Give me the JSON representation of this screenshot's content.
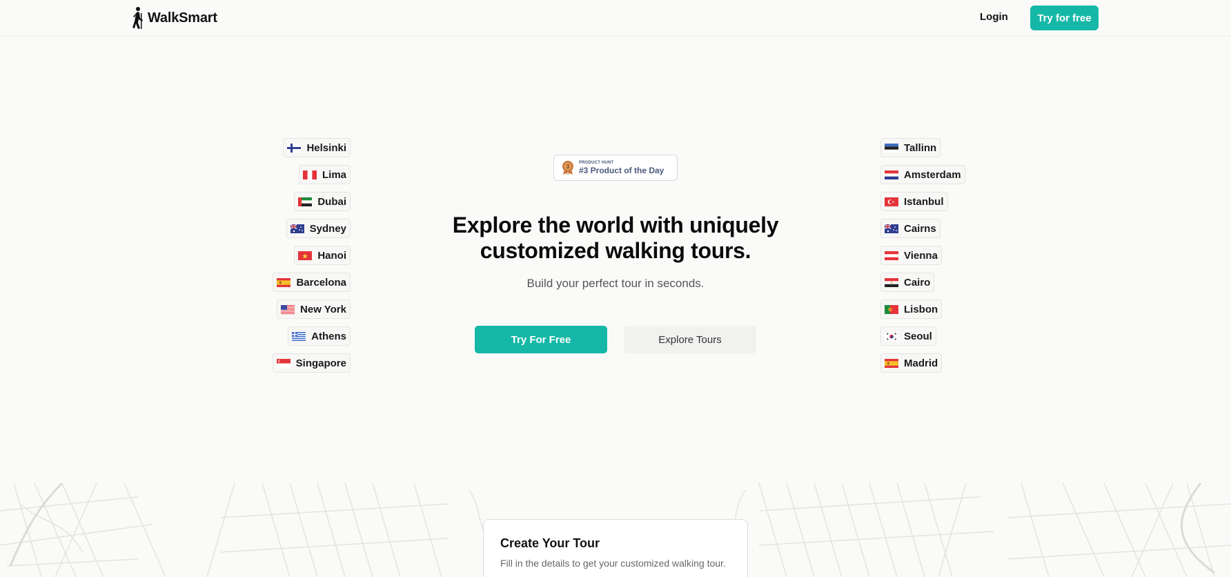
{
  "header": {
    "brand": "WalkSmart",
    "login_label": "Login",
    "try_label": "Try for free"
  },
  "badge": {
    "small": "PRODUCT HUNT",
    "big": "#3 Product of the Day"
  },
  "hero": {
    "title": "Explore the world with uniquely customized walking tours.",
    "subtitle": "Build your perfect tour in seconds.",
    "primary_label": "Try For Free",
    "secondary_label": "Explore Tours"
  },
  "cities_left": [
    {
      "name": "Helsinki",
      "flag": "finland-flag-icon"
    },
    {
      "name": "Lima",
      "flag": "peru-flag-icon"
    },
    {
      "name": "Dubai",
      "flag": "uae-flag-icon"
    },
    {
      "name": "Sydney",
      "flag": "australia-flag-icon"
    },
    {
      "name": "Hanoi",
      "flag": "vietnam-flag-icon"
    },
    {
      "name": "Barcelona",
      "flag": "spain-flag-icon"
    },
    {
      "name": "New York",
      "flag": "usa-flag-icon"
    },
    {
      "name": "Athens",
      "flag": "greece-flag-icon"
    },
    {
      "name": "Singapore",
      "flag": "singapore-flag-icon"
    }
  ],
  "cities_right": [
    {
      "name": "Tallinn",
      "flag": "estonia-flag-icon"
    },
    {
      "name": "Amsterdam",
      "flag": "netherlands-flag-icon"
    },
    {
      "name": "Istanbul",
      "flag": "turkey-flag-icon"
    },
    {
      "name": "Cairns",
      "flag": "australia-flag-icon"
    },
    {
      "name": "Vienna",
      "flag": "austria-flag-icon"
    },
    {
      "name": "Cairo",
      "flag": "egypt-flag-icon"
    },
    {
      "name": "Lisbon",
      "flag": "portugal-flag-icon"
    },
    {
      "name": "Seoul",
      "flag": "south-korea-flag-icon"
    },
    {
      "name": "Madrid",
      "flag": "spain-flag-icon"
    }
  ],
  "card": {
    "title": "Create Your Tour",
    "subtitle": "Fill in the details to get your customized walking tour."
  },
  "colors": {
    "accent": "#15b8a6",
    "background": "#fafaf9"
  }
}
